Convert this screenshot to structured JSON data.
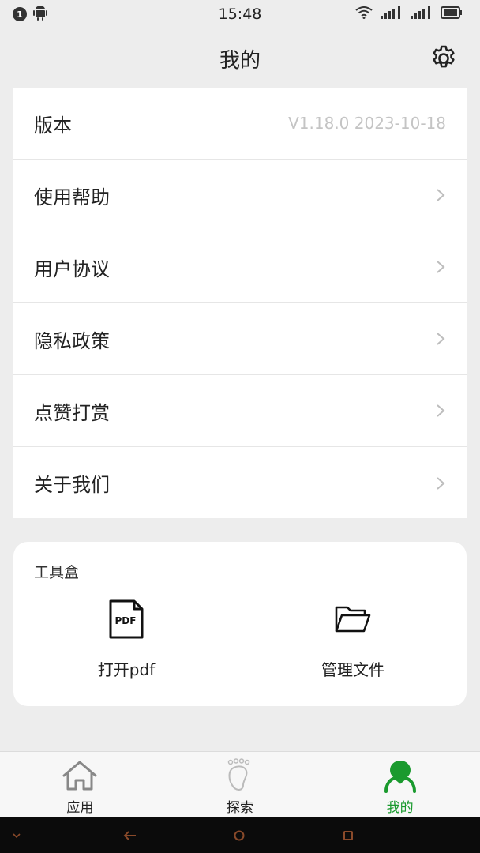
{
  "status_bar": {
    "notification_count": "1",
    "time": "15:48"
  },
  "header": {
    "title": "我的"
  },
  "menu": {
    "items": [
      {
        "label": "版本",
        "value": "V1.18.0 2023-10-18"
      },
      {
        "label": "使用帮助"
      },
      {
        "label": "用户协议"
      },
      {
        "label": "隐私政策"
      },
      {
        "label": "点赞打赏"
      },
      {
        "label": "关于我们"
      }
    ]
  },
  "toolbox": {
    "title": "工具盒",
    "tools": [
      {
        "label": "打开pdf",
        "icon": "pdf-file-icon"
      },
      {
        "label": "管理文件",
        "icon": "folder-open-icon"
      }
    ]
  },
  "bottom_nav": {
    "items": [
      {
        "label": "应用",
        "icon": "home-icon"
      },
      {
        "label": "探索",
        "icon": "footprint-icon"
      },
      {
        "label": "我的",
        "icon": "profile-icon",
        "active": true
      }
    ]
  },
  "colors": {
    "accent": "#1a9a2e",
    "background": "#ededed",
    "card": "#ffffff"
  }
}
